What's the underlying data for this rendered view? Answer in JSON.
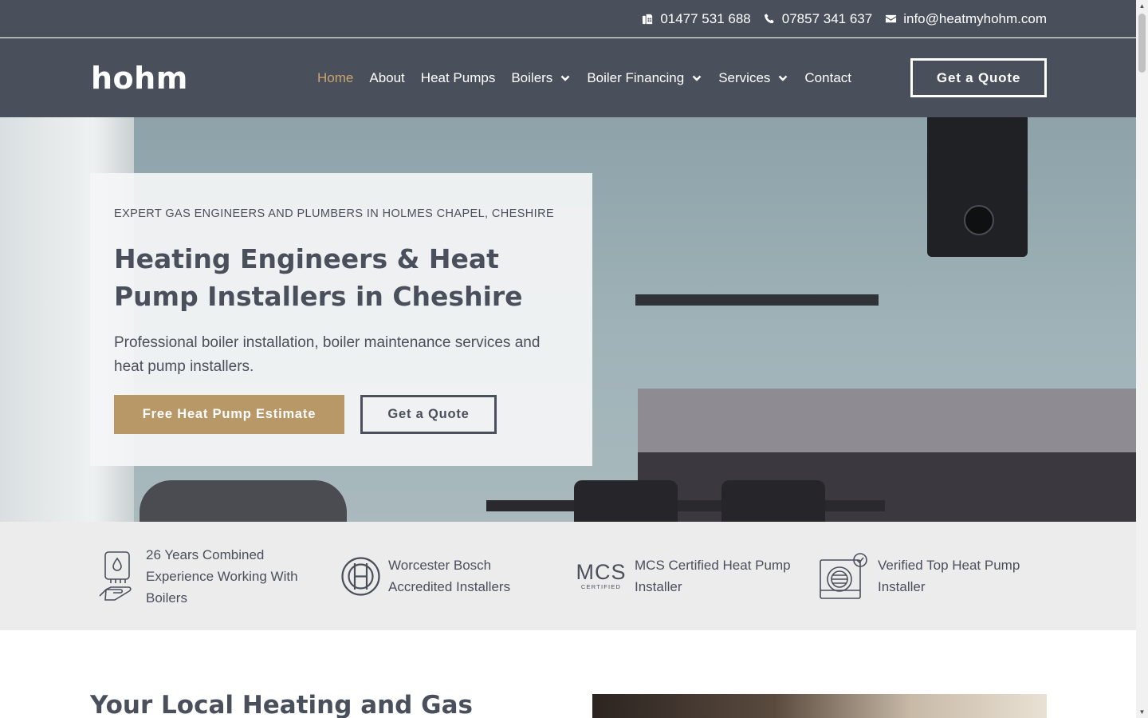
{
  "topbar": {
    "landline": "01477 531 688",
    "mobile": "07857 341 637",
    "email": "info@heatmyhohm.com"
  },
  "header": {
    "logo": "hohm",
    "nav": [
      {
        "label": "Home",
        "active": true
      },
      {
        "label": "About"
      },
      {
        "label": "Heat Pumps"
      },
      {
        "label": "Boilers",
        "dropdown": true
      },
      {
        "label": "Boiler Financing",
        "dropdown": true
      },
      {
        "label": "Services",
        "dropdown": true
      },
      {
        "label": "Contact"
      }
    ],
    "cta": "Get a Quote"
  },
  "hero": {
    "eyebrow": "EXPERT GAS ENGINEERS AND PLUMBERS IN HOLMES CHAPEL, CHESHIRE",
    "title": "Heating Engineers & Heat Pump Installers in Cheshire",
    "subtitle": "Professional boiler installation, boiler maintenance services and heat pump installers.",
    "primary_button": "Free Heat Pump Estimate",
    "secondary_button": "Get a Quote"
  },
  "features": [
    {
      "icon": "boiler-hand-icon",
      "text": "26 Years Combined Experience Working With Boilers"
    },
    {
      "icon": "bosch-logo-icon",
      "text": "Worcester Bosch Accredited Installers"
    },
    {
      "icon": "mcs-certified-logo",
      "text": "MCS Certified Heat Pump Installer",
      "logo_text": "MCS",
      "logo_subtext": "CERTIFIED"
    },
    {
      "icon": "heat-pump-award-icon",
      "text": "Verified Top Heat Pump Installer"
    }
  ],
  "section": {
    "title": "Your Local Heating and Gas"
  },
  "colors": {
    "header_bg": "#4a4f5c",
    "accent": "#b99868",
    "active_nav": "#c9a56f",
    "features_bg": "#ececec"
  }
}
